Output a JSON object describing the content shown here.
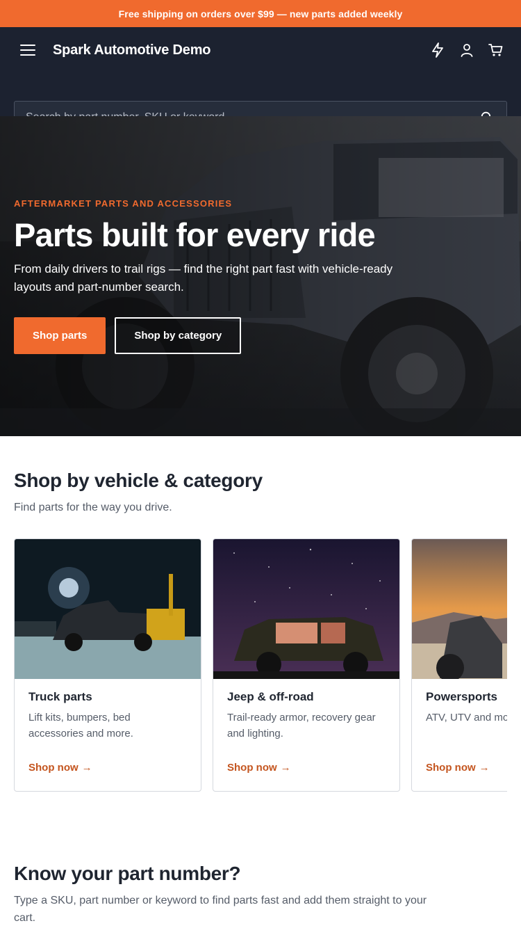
{
  "promo": {
    "text": "Free shipping on orders over $99 — new parts added weekly"
  },
  "header": {
    "brand": "Spark Automotive Demo",
    "icons": [
      "menu-icon",
      "lightning-icon",
      "account-icon",
      "cart-icon"
    ]
  },
  "search": {
    "placeholder": "Search by part number, SKU or keyword"
  },
  "hero": {
    "eyebrow": "AFTERMARKET PARTS AND ACCESSORIES",
    "title": "Parts built for every ride",
    "subtitle": "From daily drivers to trail rigs — find the right part fast with vehicle-ready layouts and part-number search.",
    "cta_primary": "Shop parts",
    "cta_secondary": "Shop by category"
  },
  "categories": {
    "title": "Shop by vehicle & category",
    "subtitle": "Find parts for the way you drive.",
    "cards": [
      {
        "title": "Truck parts",
        "description": "Lift kits, bumpers, bed accessories and more.",
        "link": "Shop now"
      },
      {
        "title": "Jeep & off-road",
        "description": "Trail-ready armor, recovery gear and lighting.",
        "link": "Shop now"
      },
      {
        "title": "Powersports",
        "description": "ATV, UTV and mo",
        "link": "Shop now"
      }
    ]
  },
  "part_number": {
    "title": "Know your part number?",
    "subtitle": "Type a SKU, part number or keyword to find parts fast and add them straight to your cart."
  },
  "colors": {
    "accent": "#f06a2e",
    "header_bg": "#1c2230",
    "link": "#c4551f"
  }
}
